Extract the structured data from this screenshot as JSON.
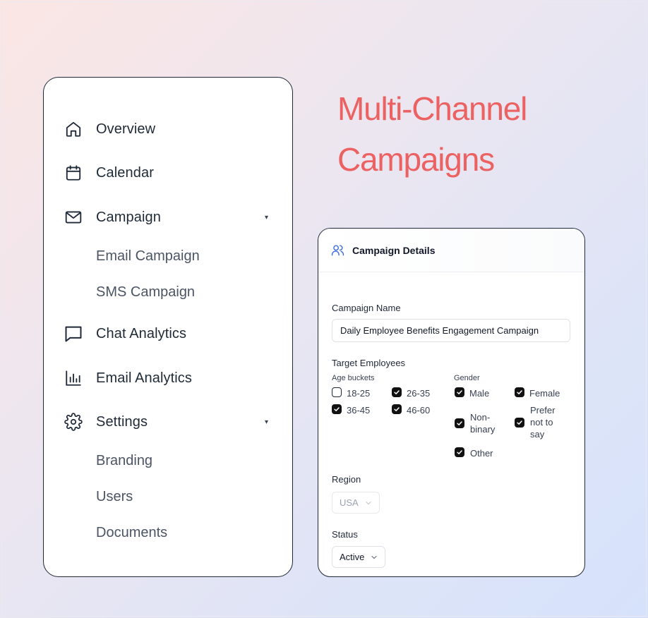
{
  "sidebar": {
    "items": [
      {
        "label": "Overview",
        "icon": "home-icon"
      },
      {
        "label": "Calendar",
        "icon": "calendar-icon"
      },
      {
        "label": "Campaign",
        "icon": "mail-icon",
        "expandable": true,
        "children": [
          {
            "label": "Email Campaign"
          },
          {
            "label": "SMS Campaign"
          }
        ]
      },
      {
        "label": "Chat Analytics",
        "icon": "chat-icon"
      },
      {
        "label": "Email Analytics",
        "icon": "bar-chart-icon"
      },
      {
        "label": "Settings",
        "icon": "gear-icon",
        "expandable": true,
        "children": [
          {
            "label": "Branding"
          },
          {
            "label": "Users"
          },
          {
            "label": "Documents"
          }
        ]
      }
    ],
    "caret_glyph": "▾"
  },
  "headline": {
    "line1": "Multi-Channel",
    "line2": "Campaigns",
    "color": "#ec6161"
  },
  "details": {
    "title": "Campaign Details",
    "title_icon": "users-icon",
    "campaign_name": {
      "label": "Campaign Name",
      "value": "Daily Employee Benefits Engagement Campaign"
    },
    "target": {
      "label": "Target Employees",
      "age": {
        "label": "Age buckets",
        "options": [
          {
            "label": "18-25",
            "checked": false
          },
          {
            "label": "26-35",
            "checked": true
          },
          {
            "label": "36-45",
            "checked": true
          },
          {
            "label": "46-60",
            "checked": true
          }
        ]
      },
      "gender": {
        "label": "Gender",
        "options": [
          {
            "label": "Male",
            "checked": true
          },
          {
            "label": "Female",
            "checked": true
          },
          {
            "label": "Non-\nbinary",
            "checked": true
          },
          {
            "label": "Prefer\nnot to\nsay",
            "checked": true
          },
          {
            "label": "Other",
            "checked": true
          }
        ]
      }
    },
    "region": {
      "label": "Region",
      "value": "USA",
      "disabled": true
    },
    "status": {
      "label": "Status",
      "value": "Active"
    }
  }
}
